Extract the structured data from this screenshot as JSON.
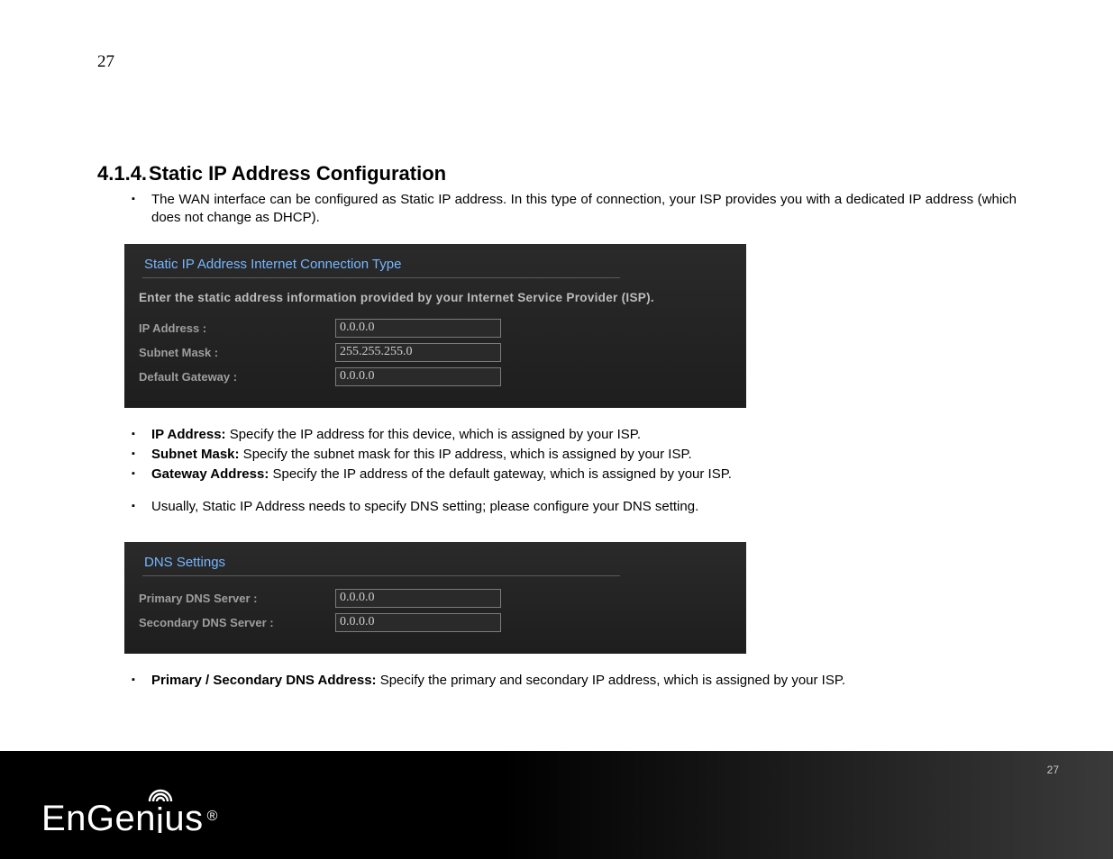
{
  "page": {
    "top_number": "27",
    "footer_number": "27"
  },
  "heading": {
    "number": "4.1.4.",
    "title": "Static IP Address Configuration"
  },
  "intro": "The WAN interface can be configured as Static IP address. In this type of connection, your ISP provides you with a dedicated IP address (which does not change as DHCP).",
  "static_panel": {
    "title": "Static IP Address Internet Connection Type",
    "instruction": "Enter the static address information provided by your Internet Service Provider (ISP).",
    "fields": {
      "ip_label": "IP Address :",
      "ip_value": "0.0.0.0",
      "mask_label": "Subnet Mask :",
      "mask_value": "255.255.255.0",
      "gw_label": "Default Gateway :",
      "gw_value": "0.0.0.0"
    }
  },
  "desc": {
    "ip_b": "IP Address:",
    "ip_t": " Specify the IP address for this device, which is assigned by your ISP.",
    "mask_b": "Subnet Mask:",
    "mask_t": " Specify the subnet mask for this IP address, which is assigned by your ISP.",
    "gw_b": "Gateway Address:",
    "gw_t": " Specify the IP address of the default gateway, which is assigned by your ISP.",
    "dns_note": "Usually, Static IP Address needs to specify DNS setting; please configure your DNS setting."
  },
  "dns_panel": {
    "title": "DNS Settings",
    "fields": {
      "p_label": "Primary DNS Server :",
      "p_value": "0.0.0.0",
      "s_label": "Secondary DNS Server :",
      "s_value": "0.0.0.0"
    }
  },
  "dns_desc": {
    "b": "Primary / Secondary DNS Address:",
    "t": " Specify the primary and secondary IP address, which is assigned by your ISP."
  },
  "brand": {
    "name": "EnGenius",
    "reg": "®"
  }
}
